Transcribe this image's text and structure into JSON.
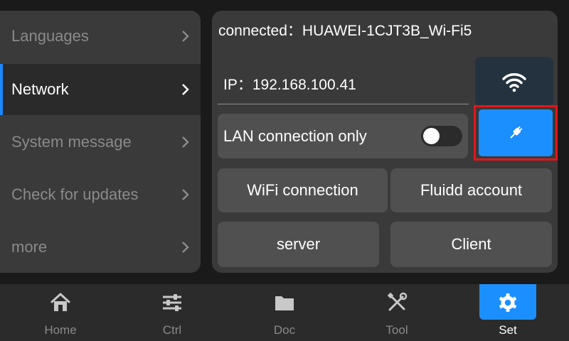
{
  "menu": {
    "items": [
      {
        "label": "Languages",
        "active": false
      },
      {
        "label": "Network",
        "active": true
      },
      {
        "label": "System message",
        "active": false
      },
      {
        "label": "Check for updates",
        "active": false
      },
      {
        "label": "more",
        "active": false
      }
    ]
  },
  "network": {
    "connected_text": "connected：HUAWEI-1CJT3B_Wi-Fi5",
    "ip_text": "IP：192.168.100.41",
    "lan_only_label": "LAN connection only",
    "lan_only_enabled": false,
    "buttons": {
      "wifi_connection": "WiFi connection",
      "fluidd_account": "Fluidd account",
      "server": "server",
      "client": "Client"
    },
    "icons": {
      "wifi": "wifi-icon",
      "plug": "plug-icon"
    }
  },
  "nav": {
    "items": [
      {
        "label": "Home",
        "icon": "home-icon"
      },
      {
        "label": "Ctrl",
        "icon": "sliders-icon"
      },
      {
        "label": "Doc",
        "icon": "folder-icon"
      },
      {
        "label": "Tool",
        "icon": "tools-icon"
      },
      {
        "label": "Set",
        "icon": "gear-icon",
        "active": true
      }
    ]
  },
  "colors": {
    "accent": "#1c8fff",
    "highlight_border": "#e3151a",
    "panel": "#3a3a3a",
    "background": "#1a1a1a"
  }
}
